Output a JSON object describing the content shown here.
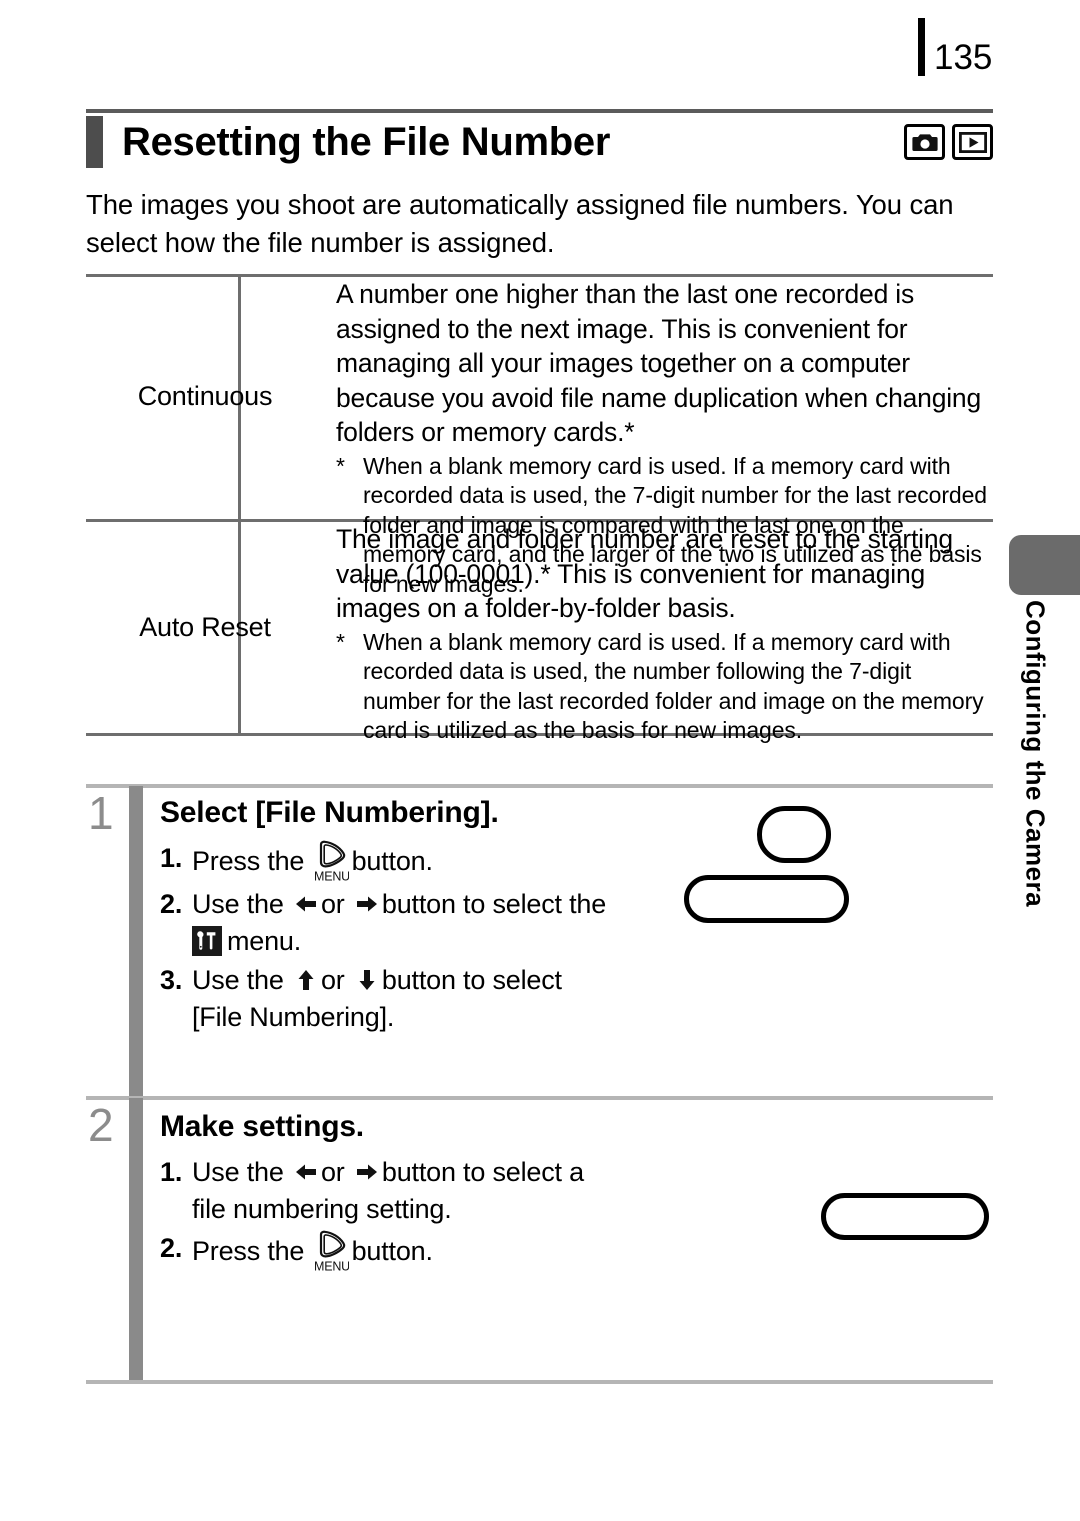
{
  "page": {
    "number": "135",
    "chapter_tab_label": "Configuring the Camera"
  },
  "header": {
    "title": "Resetting the File Number",
    "mode_icons": [
      "camera-icon",
      "playback-icon"
    ]
  },
  "intro": {
    "text": "The images you shoot are automatically assigned file numbers. You can select how the file number is assigned."
  },
  "table": {
    "rows": [
      {
        "label": "Continuous",
        "description": "A number one higher than the last one recorded is assigned to the next image. This is convenient for managing all your images together on a computer because you avoid file name duplication when changing folders or memory cards.*",
        "note_marker": "*",
        "note": "When a blank memory card is used. If a memory card with recorded data is used, the 7-digit number for the last recorded folder and image is compared with the last one on the memory card, and the larger of the two is utilized as the basis for new images."
      },
      {
        "label": "Auto Reset",
        "description": "The image and folder number are reset to the starting value (100-0001).* This is convenient for managing images on a folder-by-folder basis.",
        "note_marker": "*",
        "note": "When a blank memory card is used. If a memory card with recorded data is used, the number following the 7-digit number for the last recorded folder and image on the memory card is utilized as the basis for new images."
      }
    ]
  },
  "steps": [
    {
      "number": "1",
      "title": "Select [File Numbering].",
      "substeps": [
        {
          "number": "1.",
          "before": "Press the",
          "icon": "menu-button-icon",
          "icon_label": "MENU",
          "after": "button."
        },
        {
          "number": "2.",
          "before": "Use the",
          "icon_left": "arrow-left-icon",
          "middle": "or",
          "icon_right": "arrow-right-icon",
          "after": "button to select the",
          "tile_icon": "settings-tools-icon",
          "tail": "menu."
        },
        {
          "number": "3.",
          "before": "Use the",
          "icon_left": "arrow-up-icon",
          "middle": "or",
          "icon_right": "arrow-down-icon",
          "after": "button to select",
          "tail": "[File Numbering]."
        }
      ]
    },
    {
      "number": "2",
      "title": "Make settings.",
      "substeps": [
        {
          "number": "1.",
          "before": "Use the",
          "icon_left": "arrow-left-icon",
          "middle": "or",
          "icon_right": "arrow-right-icon",
          "after": "button to select a",
          "tail": "file numbering setting."
        },
        {
          "number": "2.",
          "before": "Press the",
          "icon": "menu-button-icon",
          "icon_label": "MENU",
          "after": "button."
        }
      ]
    }
  ],
  "colors": {
    "rule_dark": "#5b5b5b",
    "rule_light": "#b5b5b5",
    "step_gray": "#8a8a8a",
    "tab_gray": "#6b6b6b"
  }
}
